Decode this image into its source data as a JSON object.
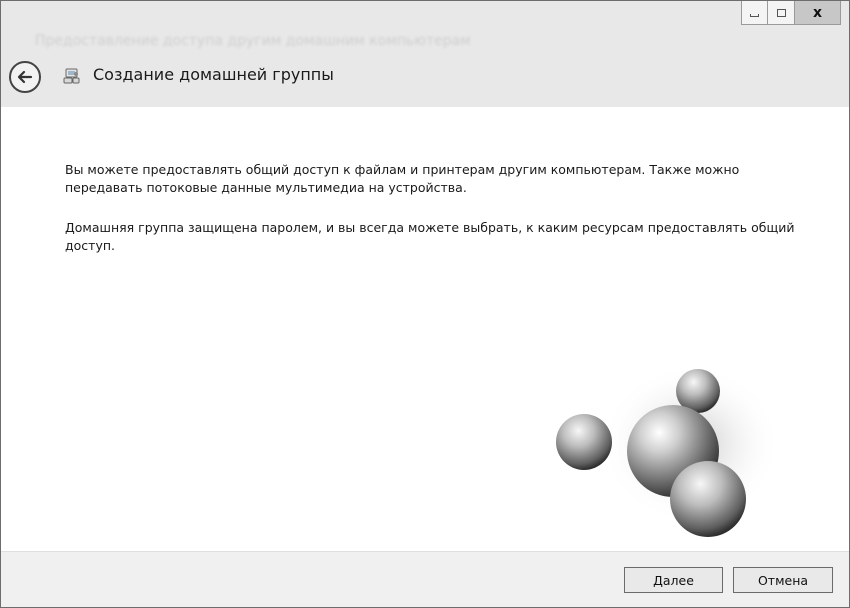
{
  "window": {
    "ghost_title": "Предоставление доступа другим домашним компьютерам"
  },
  "header": {
    "title": "Создание домашней группы",
    "back_icon": "back-arrow-icon",
    "app_icon": "homegroup-icon"
  },
  "controls": {
    "close_label": "x"
  },
  "content": {
    "paragraph1": "Вы можете предоставлять общий доступ к файлам и принтерам другим компьютерам. Также можно передавать потоковые данные мультимедиа на устройства.",
    "paragraph2": "Домашняя группа защищена паролем, и вы всегда можете выбрать, к каким ресурсам предоставлять общий доступ."
  },
  "footer": {
    "next_label": "Далее",
    "cancel_label": "Отмена"
  }
}
